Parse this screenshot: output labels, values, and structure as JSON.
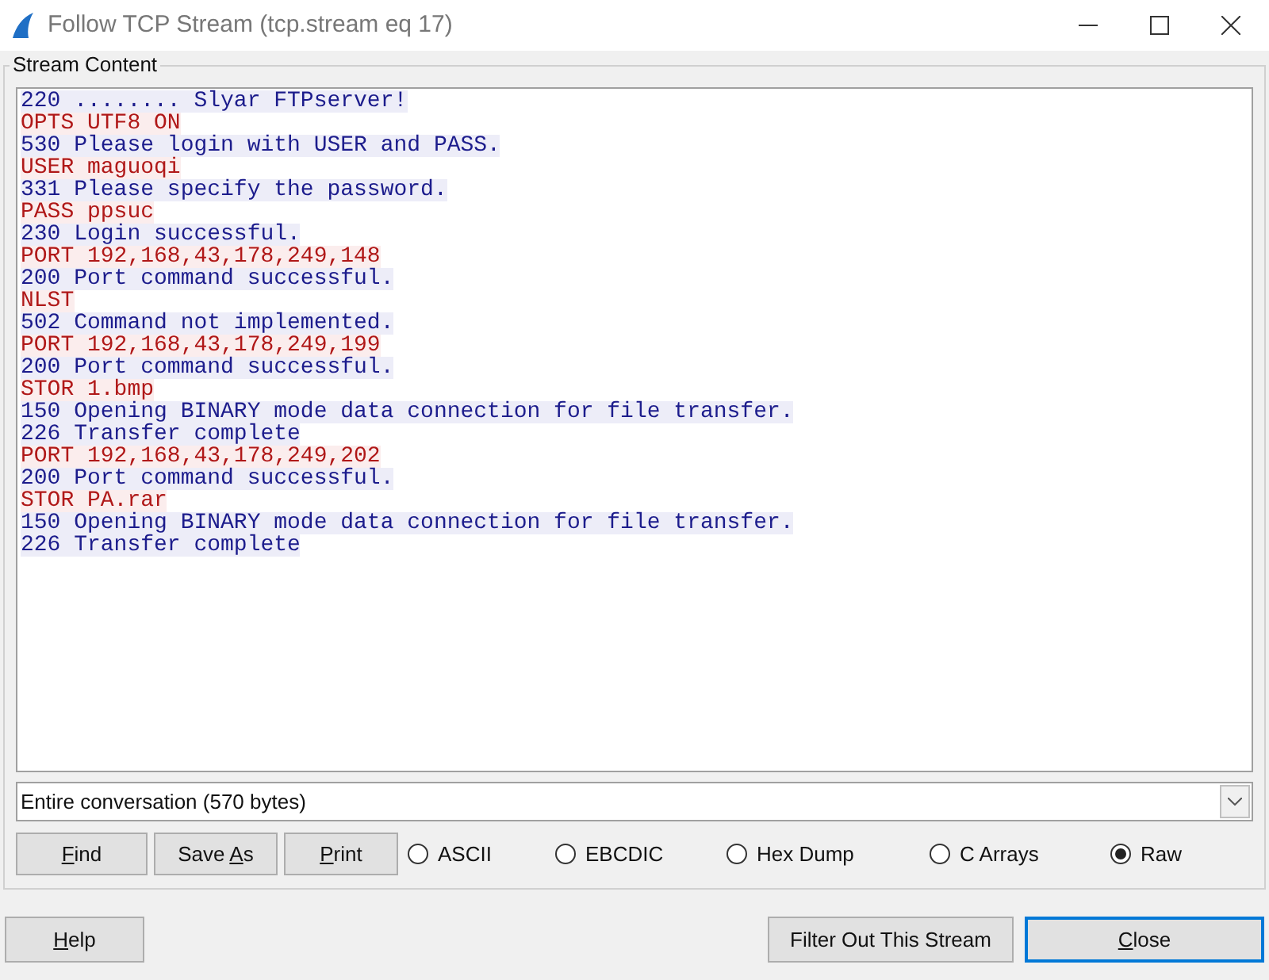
{
  "window": {
    "title": "Follow TCP Stream (tcp.stream eq 17)"
  },
  "stream_content": {
    "title": "Stream Content",
    "lines": [
      {
        "kind": "server",
        "text": "220 ........ Slyar FTPserver!"
      },
      {
        "kind": "client",
        "text": "OPTS UTF8 ON"
      },
      {
        "kind": "server",
        "text": "530 Please login with USER and PASS."
      },
      {
        "kind": "client",
        "text": "USER maguoqi"
      },
      {
        "kind": "server",
        "text": "331 Please specify the password."
      },
      {
        "kind": "client",
        "text": "PASS ppsuc"
      },
      {
        "kind": "server",
        "text": "230 Login successful."
      },
      {
        "kind": "client",
        "text": "PORT 192,168,43,178,249,148"
      },
      {
        "kind": "server",
        "text": "200 Port command successful."
      },
      {
        "kind": "client",
        "text": "NLST"
      },
      {
        "kind": "server",
        "text": "502 Command not implemented."
      },
      {
        "kind": "client",
        "text": "PORT 192,168,43,178,249,199"
      },
      {
        "kind": "server",
        "text": "200 Port command successful."
      },
      {
        "kind": "client",
        "text": "STOR 1.bmp"
      },
      {
        "kind": "server",
        "text": "150 Opening BINARY mode data connection for file transfer."
      },
      {
        "kind": "server",
        "text": "226 Transfer complete"
      },
      {
        "kind": "client",
        "text": "PORT 192,168,43,178,249,202"
      },
      {
        "kind": "server",
        "text": "200 Port command successful."
      },
      {
        "kind": "client",
        "text": "STOR PA.rar"
      },
      {
        "kind": "server",
        "text": "150 Opening BINARY mode data connection for file transfer."
      },
      {
        "kind": "server",
        "text": "226 Transfer complete"
      }
    ],
    "conversation_select": {
      "value": "Entire conversation (570 bytes)"
    },
    "buttons": [
      {
        "key": "F",
        "after": "ind"
      },
      {
        "before": "Save ",
        "key": "A",
        "after": "s"
      },
      {
        "key": "P",
        "after": "rint"
      }
    ],
    "formats": [
      {
        "label": "ASCII",
        "selected": false
      },
      {
        "label": "EBCDIC",
        "selected": false
      },
      {
        "label": "Hex Dump",
        "selected": false
      },
      {
        "label": "C Arrays",
        "selected": false
      },
      {
        "label": "Raw",
        "selected": true
      }
    ]
  },
  "footer_buttons": [
    {
      "key": "H",
      "after": "elp",
      "default": false
    },
    {
      "before": "Filter Out This Stream",
      "default": false
    },
    {
      "key": "C",
      "after": "lose",
      "default": true
    }
  ]
}
